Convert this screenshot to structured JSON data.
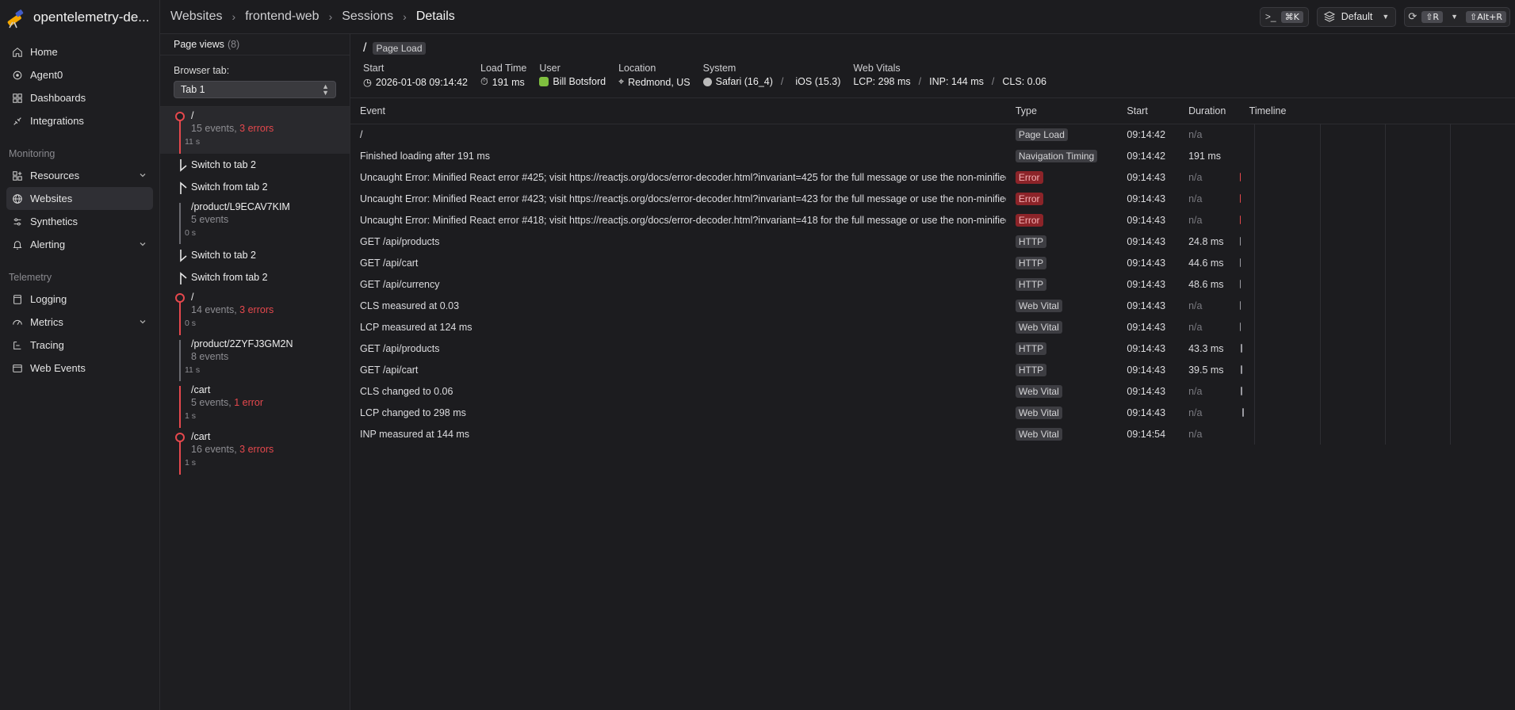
{
  "app": {
    "name": "opentelemetry-de..."
  },
  "nav": {
    "items": [
      {
        "label": "Home",
        "icon": "home-icon"
      },
      {
        "label": "Agent0",
        "icon": "agent-icon"
      },
      {
        "label": "Dashboards",
        "icon": "dashboard-icon"
      },
      {
        "label": "Integrations",
        "icon": "integrations-icon"
      }
    ],
    "monitoring_label": "Monitoring",
    "monitoring": [
      {
        "label": "Resources",
        "icon": "resources-icon",
        "expandable": true
      },
      {
        "label": "Websites",
        "icon": "globe-icon",
        "active": true
      },
      {
        "label": "Synthetics",
        "icon": "synthetics-icon"
      },
      {
        "label": "Alerting",
        "icon": "bell-icon",
        "expandable": true
      }
    ],
    "telemetry_label": "Telemetry",
    "telemetry": [
      {
        "label": "Logging",
        "icon": "logging-icon"
      },
      {
        "label": "Metrics",
        "icon": "metrics-icon",
        "expandable": true
      },
      {
        "label": "Tracing",
        "icon": "tracing-icon"
      },
      {
        "label": "Web Events",
        "icon": "web-events-icon"
      }
    ]
  },
  "breadcrumb": [
    "Websites",
    "frontend-web",
    "Sessions",
    "Details"
  ],
  "toolbar": {
    "command_kbd": "⌘K",
    "default_label": "Default",
    "refresh_kbd": "⇧R",
    "alt_kbd": "⇧Alt+R"
  },
  "page_views": {
    "title": "Page views",
    "count": "(8)",
    "browser_tab_label": "Browser tab:",
    "browser_tab_value": "Tab 1",
    "rows": [
      {
        "kind": "page",
        "path": "/",
        "events": "15 events,",
        "errors": "3 errors",
        "duration": "11 s",
        "selected": true,
        "has_errors": true
      },
      {
        "kind": "tab",
        "label": "Switch to tab 2"
      },
      {
        "kind": "tab",
        "label": "Switch from tab 2"
      },
      {
        "kind": "page",
        "path": "/product/L9ECAV7KIM",
        "events": "5 events",
        "errors": "",
        "duration": "0 s",
        "has_errors": false
      },
      {
        "kind": "tab",
        "label": "Switch to tab 2"
      },
      {
        "kind": "tab",
        "label": "Switch from tab 2"
      },
      {
        "kind": "page",
        "path": "/",
        "events": "14 events,",
        "errors": "3 errors",
        "duration": "0 s",
        "has_errors": true
      },
      {
        "kind": "page",
        "path": "/product/2ZYFJ3GM2N",
        "events": "8 events",
        "errors": "",
        "duration": "11 s",
        "has_errors": false
      },
      {
        "kind": "page",
        "path": "/cart",
        "events": "5 events,",
        "errors": "1 error",
        "duration": "1 s",
        "has_errors": false
      },
      {
        "kind": "page",
        "path": "/cart",
        "events": "16 events,",
        "errors": "3 errors",
        "duration": "1 s",
        "has_errors": true
      }
    ]
  },
  "details": {
    "path": "/",
    "type_tag": "Page Load",
    "meta": {
      "start_label": "Start",
      "start_value": "2026-01-08 09:14:42",
      "load_label": "Load Time",
      "load_value": "191 ms",
      "user_label": "User",
      "user_value": "Bill Botsford",
      "location_label": "Location",
      "location_value": "Redmond, US",
      "system_label": "System",
      "browser": "Safari (16_4)",
      "os": "iOS (15.3)",
      "vitals_label": "Web Vitals",
      "lcp": "LCP: 298 ms",
      "inp": "INP: 144 ms",
      "cls": "CLS: 0.06"
    },
    "columns": [
      "Event",
      "Type",
      "Start",
      "Duration",
      "Timeline"
    ],
    "events": [
      {
        "event": "/",
        "type": "Page Load",
        "start": "09:14:42",
        "duration": "n/a",
        "tl": 0.0,
        "kind": "neutral"
      },
      {
        "event": "Finished loading after 191 ms",
        "type": "Navigation Timing",
        "start": "09:14:42",
        "duration": "191 ms",
        "tl": 0.0,
        "kind": "pill"
      },
      {
        "event": "Uncaught Error: Minified React error #425; visit https://reactjs.org/docs/error-decoder.html?invariant=425 for the full message or use the non-minified dev environment",
        "type": "Error",
        "start": "09:14:43",
        "duration": "n/a",
        "tl": 0.02,
        "kind": "error"
      },
      {
        "event": "Uncaught Error: Minified React error #423; visit https://reactjs.org/docs/error-decoder.html?invariant=423 for the full message or use the non-minified dev environment",
        "type": "Error",
        "start": "09:14:43",
        "duration": "n/a",
        "tl": 0.02,
        "kind": "error"
      },
      {
        "event": "Uncaught Error: Minified React error #418; visit https://reactjs.org/docs/error-decoder.html?invariant=418 for the full message or use the non-minified dev environment",
        "type": "Error",
        "start": "09:14:43",
        "duration": "n/a",
        "tl": 0.02,
        "kind": "error"
      },
      {
        "event": "GET /api/products",
        "type": "HTTP",
        "start": "09:14:43",
        "duration": "24.8 ms",
        "tl": 0.02,
        "kind": "neutral"
      },
      {
        "event": "GET /api/cart",
        "type": "HTTP",
        "start": "09:14:43",
        "duration": "44.6 ms",
        "tl": 0.02,
        "kind": "neutral"
      },
      {
        "event": "GET /api/currency",
        "type": "HTTP",
        "start": "09:14:43",
        "duration": "48.6 ms",
        "tl": 0.02,
        "kind": "neutral"
      },
      {
        "event": "CLS measured at 0.03",
        "type": "Web Vital",
        "start": "09:14:43",
        "duration": "n/a",
        "tl": 0.02,
        "kind": "neutral"
      },
      {
        "event": "LCP measured at 124 ms",
        "type": "Web Vital",
        "start": "09:14:43",
        "duration": "n/a",
        "tl": 0.02,
        "kind": "neutral"
      },
      {
        "event": "GET /api/products",
        "type": "HTTP",
        "start": "09:14:43",
        "duration": "43.3 ms",
        "tl": 0.025,
        "kind": "neutral"
      },
      {
        "event": "GET /api/cart",
        "type": "HTTP",
        "start": "09:14:43",
        "duration": "39.5 ms",
        "tl": 0.025,
        "kind": "neutral"
      },
      {
        "event": "CLS changed to 0.06",
        "type": "Web Vital",
        "start": "09:14:43",
        "duration": "n/a",
        "tl": 0.025,
        "kind": "neutral"
      },
      {
        "event": "LCP changed to 298 ms",
        "type": "Web Vital",
        "start": "09:14:43",
        "duration": "n/a",
        "tl": 0.03,
        "kind": "neutral"
      },
      {
        "event": "INP measured at 144 ms",
        "type": "Web Vital",
        "start": "09:14:54",
        "duration": "n/a",
        "tl": null,
        "kind": "neutral"
      }
    ]
  }
}
